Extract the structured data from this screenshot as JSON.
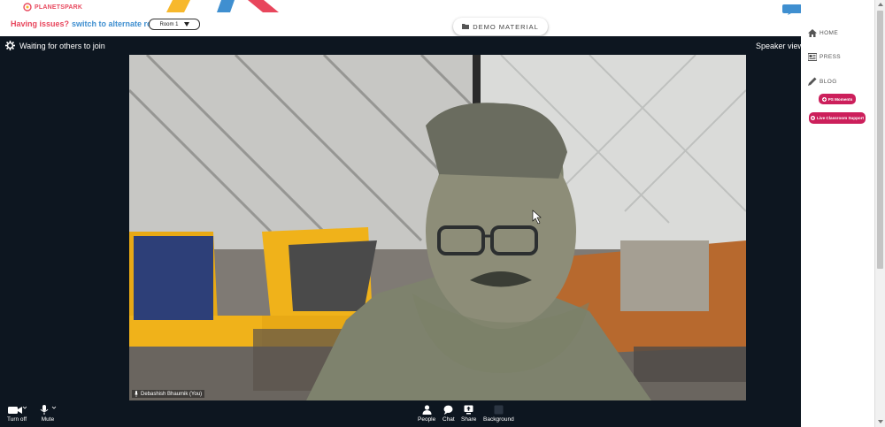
{
  "header": {
    "logo_text": "PLANETSPARK",
    "issues_text": "Having issues?",
    "switch_text": "switch to alternate room",
    "room_value": "Room 1",
    "demo_button": "DEMO MATERIAL"
  },
  "meeting": {
    "status_text": "Waiting for others to join",
    "view_mode": "Speaker view",
    "participant_name": "Debashish Bhaumik (You)"
  },
  "toolbar": {
    "video_label": "Turn off",
    "mute_label": "Mute",
    "people_label": "People",
    "chat_label": "Chat",
    "share_label": "Share",
    "background_label": "Background"
  },
  "sidebar": {
    "items": [
      {
        "label": "HOME",
        "icon": "home-icon"
      },
      {
        "label": "PRESS",
        "icon": "press-icon"
      },
      {
        "label": "BLOG",
        "icon": "pencil-icon"
      }
    ],
    "pill_moments": "PS Moments",
    "pill_support": "Live Classroom Support"
  },
  "colors": {
    "accent_red": "#e8465c",
    "accent_blue": "#3f8fd0",
    "meeting_bg": "#0d1620",
    "pill": "#cc1f5b"
  }
}
